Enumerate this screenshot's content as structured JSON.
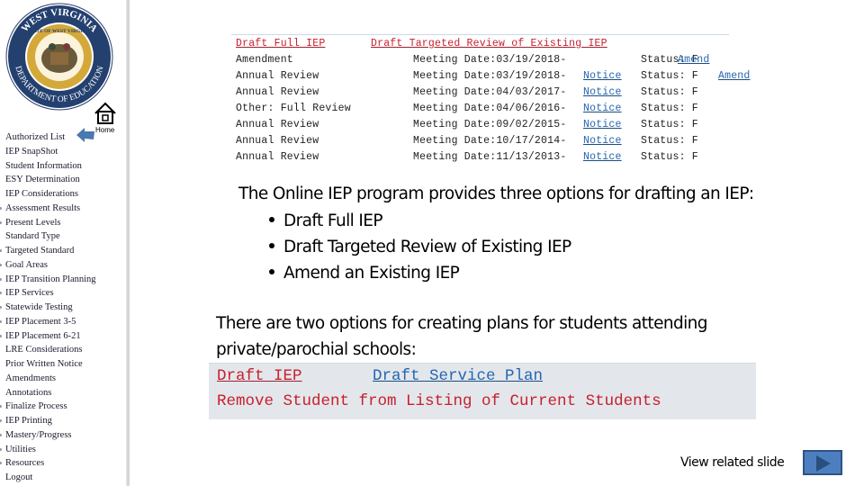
{
  "sidebar": {
    "logo_alt": "West Virginia Department of Education seal",
    "logo_text_outer_top": "WEST VIRGINIA",
    "logo_text_outer_bottom": "DEPARTMENT OF EDUCATION",
    "home_label": "Home",
    "items": [
      {
        "label": "Authorized List",
        "bullet": false
      },
      {
        "label": "IEP SnapShot",
        "bullet": false
      },
      {
        "label": "Student Information",
        "bullet": false
      },
      {
        "label": "ESY Determination",
        "bullet": false
      },
      {
        "label": "IEP Considerations",
        "bullet": false
      },
      {
        "label": "Assessment Results",
        "bullet": true
      },
      {
        "label": "Present Levels",
        "bullet": true
      },
      {
        "label": "Standard Type",
        "bullet": false
      },
      {
        "label": "Targeted Standard",
        "bullet": true
      },
      {
        "label": "Goal Areas",
        "bullet": true
      },
      {
        "label": "IEP Transition Planning",
        "bullet": true
      },
      {
        "label": "IEP Services",
        "bullet": true
      },
      {
        "label": "Statewide Testing",
        "bullet": true
      },
      {
        "label": "IEP Placement 3-5",
        "bullet": true
      },
      {
        "label": "IEP Placement 6-21",
        "bullet": true
      },
      {
        "label": "LRE Considerations",
        "bullet": false
      },
      {
        "label": "Prior Written Notice",
        "bullet": false
      },
      {
        "label": "Amendments",
        "bullet": false
      },
      {
        "label": "Annotations",
        "bullet": false
      },
      {
        "label": "Finalize Process",
        "bullet": true
      },
      {
        "label": "IEP Printing",
        "bullet": true
      },
      {
        "label": "Mastery/Progress",
        "bullet": true
      },
      {
        "label": "Utilities",
        "bullet": true
      },
      {
        "label": "Resources",
        "bullet": true
      },
      {
        "label": "Logout",
        "bullet": false
      }
    ]
  },
  "iep_panel": {
    "draft_full_label": "Draft Full IEP",
    "draft_targeted_label": "Draft Targeted Review of Existing IEP",
    "rows": [
      {
        "type": "Amendment",
        "meeting": "Meeting Date:03/19/2018-",
        "notice": "",
        "status": "Status: F",
        "amend": "Amend"
      },
      {
        "type": "Annual Review",
        "meeting": "Meeting Date:03/19/2018-",
        "notice": "Notice",
        "status": "Status: F",
        "amend": "Amend"
      },
      {
        "type": "Annual Review",
        "meeting": "Meeting Date:04/03/2017-",
        "notice": "Notice",
        "status": "Status: F",
        "amend": ""
      },
      {
        "type": "Other: Full Review",
        "meeting": "Meeting Date:04/06/2016-",
        "notice": "Notice",
        "status": "Status: F",
        "amend": ""
      },
      {
        "type": "Annual Review",
        "meeting": "Meeting Date:09/02/2015-",
        "notice": "Notice",
        "status": "Status: F",
        "amend": ""
      },
      {
        "type": "Annual Review",
        "meeting": "Meeting Date:10/17/2014-",
        "notice": "Notice",
        "status": "Status: F",
        "amend": ""
      },
      {
        "type": "Annual Review",
        "meeting": "Meeting Date:11/13/2013-",
        "notice": "Notice",
        "status": "Status: F",
        "amend": ""
      }
    ]
  },
  "content": {
    "intro": "The Online IEP program provides three options for drafting an IEP:",
    "options": [
      "Draft Full IEP",
      "Draft Targeted Review of Existing IEP",
      "Amend an Existing IEP"
    ],
    "private_line1": "There are two options for creating plans for students attending",
    "private_line2": "private/parochial schools:"
  },
  "private_panel": {
    "draft_iep": "Draft IEP",
    "draft_service_plan": "Draft Service Plan",
    "remove_student": "Remove Student from Listing of Current Students"
  },
  "footer": {
    "related_label": "View related slide"
  },
  "colors": {
    "link_red": "#c8202c",
    "link_blue": "#2666b0",
    "panel_bg": "#e3e7ec",
    "play_button": "#4d7fc0"
  }
}
